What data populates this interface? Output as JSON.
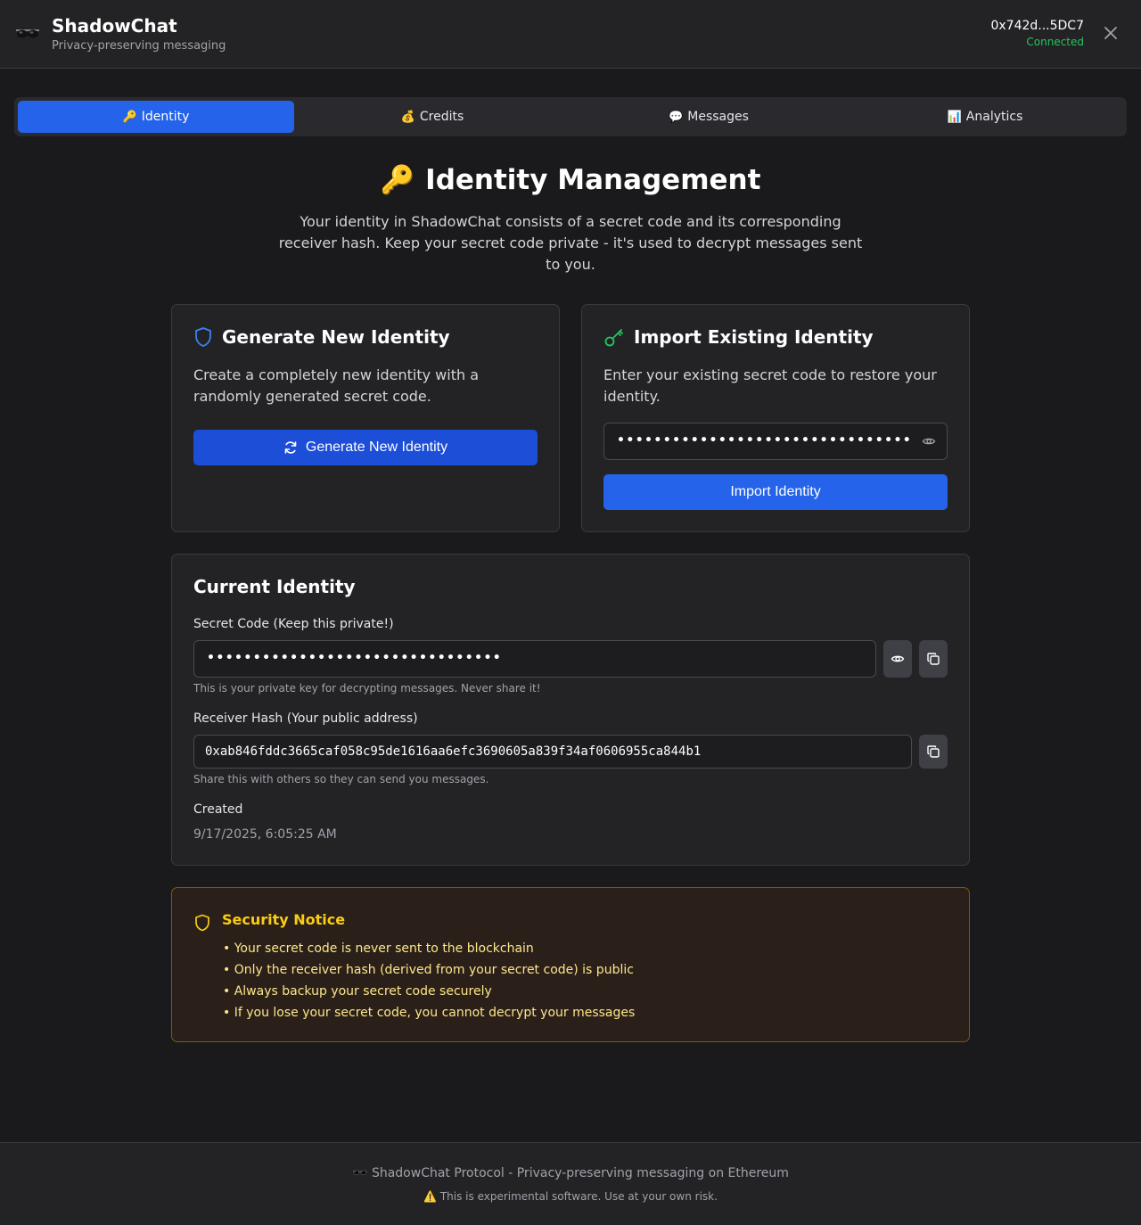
{
  "app": {
    "logo_emoji": "🕶️",
    "title": "ShadowChat",
    "subtitle": "Privacy-preserving messaging"
  },
  "wallet": {
    "address": "0x742d...5DC7",
    "status": "Connected"
  },
  "tabs": [
    {
      "emoji": "🔑",
      "label": "Identity",
      "active": true
    },
    {
      "emoji": "💰",
      "label": "Credits",
      "active": false
    },
    {
      "emoji": "💬",
      "label": "Messages",
      "active": false
    },
    {
      "emoji": "📊",
      "label": "Analytics",
      "active": false
    }
  ],
  "hero": {
    "emoji": "🔑",
    "title": "Identity Management",
    "description": "Your identity in ShadowChat consists of a secret code and its corresponding receiver hash. Keep your secret code private - it's used to decrypt messages sent to you."
  },
  "generate_card": {
    "title": "Generate New Identity",
    "description": "Create a completely new identity with a randomly generated secret code.",
    "button_label": "Generate New Identity"
  },
  "import_card": {
    "title": "Import Existing Identity",
    "description": "Enter your existing secret code to restore your identity.",
    "input_value": "••••••••••••••••••••••••••••••••",
    "button_label": "Import Identity"
  },
  "current_identity": {
    "title": "Current Identity",
    "secret_label": "Secret Code (Keep this private!)",
    "secret_value": "••••••••••••••••••••••••••••••••",
    "secret_help": "This is your private key for decrypting messages. Never share it!",
    "hash_label": "Receiver Hash (Your public address)",
    "hash_value": "0xab846fddc3665caf058c95de1616aa6efc3690605a839f34af0606955ca844b1",
    "hash_help": "Share this with others so they can send you messages.",
    "created_label": "Created",
    "created_value": "9/17/2025, 6:05:25 AM"
  },
  "security_notice": {
    "title": "Security Notice",
    "items": [
      "• Your secret code is never sent to the blockchain",
      "• Only the receiver hash (derived from your secret code) is public",
      "• Always backup your secret code securely",
      "• If you lose your secret code, you cannot decrypt your messages"
    ]
  },
  "footer": {
    "line1": "🕶️ ShadowChat Protocol - Privacy-preserving messaging on Ethereum",
    "line2": "⚠️ This is experimental software. Use at your own risk."
  },
  "colors": {
    "accent": "#2563eb",
    "connected": "#22c55e",
    "warning": "#facc15",
    "shield": "#3b82f6",
    "key_green": "#22c55e"
  }
}
